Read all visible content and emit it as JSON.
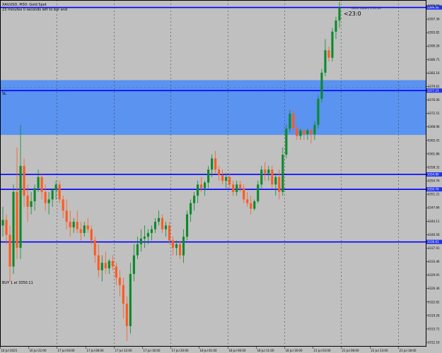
{
  "header": {
    "symbol_line": "XAUUSD, M30: Gold Spot",
    "timer_line": "23 minutes 0 seconds left to bar end"
  },
  "countdown": "<23:0",
  "sl_label": "SL",
  "position_label": "BUY 1 at 3350.11",
  "line_labels": {
    "top": "0001 (Open) 1.23.00"
  },
  "colors": {
    "background": "#c0c0c0",
    "bull": "#0b8a2b",
    "bear": "#ff5a1f",
    "zone_fill": "#5b93f0",
    "hline": "#0000ff",
    "price_tag": "#2233ee",
    "grid": "#333333"
  },
  "chart_data": {
    "type": "candlestick",
    "title": "XAUUSD, M30: Gold Spot",
    "ylim": [
      3308.5,
      3401.5
    ],
    "y_ticks": [
      "3400.56",
      "3397.36",
      "3393.81",
      "3390.26",
      "3386.71",
      "3383.16",
      "3379.61",
      "3376.06",
      "3372.51",
      "3368.96",
      "3365.41",
      "3361.86",
      "3358.31",
      "3354.76",
      "3351.21",
      "3347.66",
      "3344.11",
      "3340.56",
      "3337.01",
      "3333.46",
      "3329.91",
      "3326.36",
      "3322.81",
      "3319.26",
      "3315.71",
      "3312.16"
    ],
    "x_ticks": [
      "16 Jul 2025",
      "16 Jul 22:00",
      "17 Jul 04:00",
      "17 Jul 08:00",
      "17 Jul 12:00",
      "17 Jul 16:00",
      "17 Jul 20:00",
      "18 Jul 01:00",
      "18 Jul 06:00",
      "18 Jul 11:00",
      "18 Jul 16:00",
      "21 Jul 03:00",
      "21 Jul 08:00",
      "21 Jul 13:00",
      "21 Jul 18:00"
    ],
    "zone": {
      "top": 3380.0,
      "bottom": 3365.3
    },
    "hlines": [
      {
        "price": 3399.5,
        "label": "3399.40"
      },
      {
        "price": 3377.2,
        "label": "3377.23"
      },
      {
        "price": 3354.7,
        "label": "3354.80"
      },
      {
        "price": 3350.7,
        "label": "3350.70"
      },
      {
        "price": 3336.6,
        "label": "3336.63"
      }
    ],
    "sl_price": 3378.0,
    "ohlc": [
      [
        3341.0,
        3346.0,
        3338.0,
        3342.5
      ],
      [
        3342.5,
        3344.0,
        3336.0,
        3338.5
      ],
      [
        3338.5,
        3341.0,
        3326.0,
        3330.0
      ],
      [
        3330.0,
        3352.0,
        3328.0,
        3350.0
      ],
      [
        3350.0,
        3362.0,
        3332.0,
        3335.0
      ],
      [
        3335.0,
        3368.0,
        3332.0,
        3357.0
      ],
      [
        3357.0,
        3359.0,
        3346.0,
        3349.0
      ],
      [
        3349.0,
        3352.0,
        3342.0,
        3346.0
      ],
      [
        3346.0,
        3350.0,
        3344.0,
        3347.5
      ],
      [
        3347.5,
        3352.0,
        3345.0,
        3351.0
      ],
      [
        3351.0,
        3356.0,
        3350.0,
        3354.0
      ],
      [
        3354.0,
        3355.0,
        3348.0,
        3350.0
      ],
      [
        3350.0,
        3352.0,
        3345.0,
        3347.0
      ],
      [
        3347.0,
        3350.0,
        3344.0,
        3348.0
      ],
      [
        3348.0,
        3351.0,
        3346.0,
        3350.5
      ],
      [
        3350.5,
        3353.0,
        3348.0,
        3352.0
      ],
      [
        3352.0,
        3353.0,
        3347.0,
        3348.0
      ],
      [
        3348.0,
        3349.0,
        3343.0,
        3345.0
      ],
      [
        3345.0,
        3348.0,
        3340.0,
        3342.0
      ],
      [
        3342.0,
        3345.0,
        3338.0,
        3340.5
      ],
      [
        3340.5,
        3343.0,
        3339.0,
        3342.0
      ],
      [
        3342.0,
        3345.0,
        3339.0,
        3340.0
      ],
      [
        3340.0,
        3342.0,
        3337.0,
        3339.0
      ],
      [
        3339.0,
        3342.0,
        3338.0,
        3341.0
      ],
      [
        3341.0,
        3343.0,
        3339.0,
        3340.0
      ],
      [
        3340.0,
        3341.0,
        3336.0,
        3337.0
      ],
      [
        3337.0,
        3338.0,
        3331.0,
        3333.0
      ],
      [
        3333.0,
        3336.0,
        3327.0,
        3329.0
      ],
      [
        3329.0,
        3333.0,
        3326.0,
        3331.0
      ],
      [
        3331.0,
        3334.0,
        3328.0,
        3329.5
      ],
      [
        3329.5,
        3332.0,
        3328.0,
        3331.5
      ],
      [
        3331.5,
        3333.0,
        3329.0,
        3330.0
      ],
      [
        3330.0,
        3331.0,
        3325.0,
        3327.0
      ],
      [
        3327.0,
        3329.0,
        3322.0,
        3325.0
      ],
      [
        3325.0,
        3327.0,
        3316.0,
        3320.0
      ],
      [
        3320.0,
        3322.0,
        3310.0,
        3314.0
      ],
      [
        3314.0,
        3331.0,
        3312.0,
        3328.0
      ],
      [
        3328.0,
        3336.0,
        3326.0,
        3333.0
      ],
      [
        3333.0,
        3338.0,
        3332.0,
        3336.0
      ],
      [
        3336.0,
        3340.0,
        3334.0,
        3337.5
      ],
      [
        3337.5,
        3341.0,
        3335.0,
        3338.0
      ],
      [
        3338.0,
        3340.0,
        3336.0,
        3339.0
      ],
      [
        3339.0,
        3341.0,
        3337.0,
        3340.0
      ],
      [
        3340.0,
        3343.0,
        3339.0,
        3342.0
      ],
      [
        3342.0,
        3345.0,
        3341.0,
        3343.0
      ],
      [
        3343.0,
        3344.0,
        3339.0,
        3340.0
      ],
      [
        3340.0,
        3342.0,
        3338.0,
        3341.0
      ],
      [
        3341.0,
        3342.0,
        3336.0,
        3337.0
      ],
      [
        3337.0,
        3338.0,
        3333.0,
        3335.0
      ],
      [
        3335.0,
        3337.0,
        3333.0,
        3336.0
      ],
      [
        3336.0,
        3337.0,
        3332.0,
        3333.0
      ],
      [
        3333.0,
        3340.0,
        3331.0,
        3338.0
      ],
      [
        3338.0,
        3345.0,
        3337.0,
        3344.0
      ],
      [
        3344.0,
        3348.0,
        3342.0,
        3347.0
      ],
      [
        3347.0,
        3350.0,
        3345.0,
        3349.0
      ],
      [
        3349.0,
        3353.0,
        3347.0,
        3352.0
      ],
      [
        3352.0,
        3354.0,
        3350.0,
        3351.0
      ],
      [
        3351.0,
        3353.0,
        3349.0,
        3352.5
      ],
      [
        3352.5,
        3357.0,
        3351.0,
        3356.0
      ],
      [
        3356.0,
        3360.0,
        3354.0,
        3359.0
      ],
      [
        3359.0,
        3361.0,
        3355.0,
        3356.0
      ],
      [
        3356.0,
        3357.0,
        3353.0,
        3354.5
      ],
      [
        3354.5,
        3356.0,
        3352.0,
        3353.0
      ],
      [
        3353.0,
        3355.0,
        3351.0,
        3354.0
      ],
      [
        3354.0,
        3355.0,
        3351.0,
        3352.0
      ],
      [
        3352.0,
        3353.0,
        3349.0,
        3350.0
      ],
      [
        3350.0,
        3353.0,
        3349.0,
        3352.0
      ],
      [
        3352.0,
        3353.0,
        3350.0,
        3351.0
      ],
      [
        3351.0,
        3352.0,
        3347.0,
        3348.0
      ],
      [
        3348.0,
        3350.0,
        3346.0,
        3347.0
      ],
      [
        3347.0,
        3349.0,
        3344.0,
        3345.5
      ],
      [
        3345.5,
        3348.0,
        3345.0,
        3347.5
      ],
      [
        3347.5,
        3353.0,
        3347.0,
        3352.0
      ],
      [
        3352.0,
        3357.0,
        3351.0,
        3356.0
      ],
      [
        3356.0,
        3358.0,
        3353.0,
        3355.0
      ],
      [
        3355.0,
        3357.0,
        3353.0,
        3356.0
      ],
      [
        3356.0,
        3357.0,
        3351.0,
        3352.0
      ],
      [
        3352.0,
        3355.0,
        3349.0,
        3354.0
      ],
      [
        3354.0,
        3356.0,
        3348.0,
        3350.0
      ],
      [
        3350.0,
        3362.0,
        3349.0,
        3360.0
      ],
      [
        3360.0,
        3368.0,
        3359.0,
        3367.0
      ],
      [
        3367.0,
        3372.0,
        3366.0,
        3371.0
      ],
      [
        3371.0,
        3372.0,
        3366.0,
        3367.0
      ],
      [
        3367.0,
        3368.0,
        3364.0,
        3365.0
      ],
      [
        3365.0,
        3367.0,
        3364.0,
        3366.5
      ],
      [
        3366.5,
        3367.0,
        3364.0,
        3365.5
      ],
      [
        3365.5,
        3367.0,
        3364.0,
        3366.5
      ],
      [
        3366.5,
        3367.0,
        3363.0,
        3365.5
      ],
      [
        3365.5,
        3369.0,
        3364.0,
        3368.0
      ],
      [
        3368.0,
        3376.0,
        3367.0,
        3375.0
      ],
      [
        3375.0,
        3383.0,
        3374.0,
        3382.0
      ],
      [
        3382.0,
        3391.0,
        3381.0,
        3388.0
      ],
      [
        3388.0,
        3389.0,
        3385.0,
        3386.0
      ],
      [
        3386.0,
        3394.0,
        3385.0,
        3393.0
      ],
      [
        3393.0,
        3397.0,
        3391.0,
        3396.0
      ],
      [
        3396.0,
        3401.0,
        3394.0,
        3399.5
      ]
    ]
  }
}
